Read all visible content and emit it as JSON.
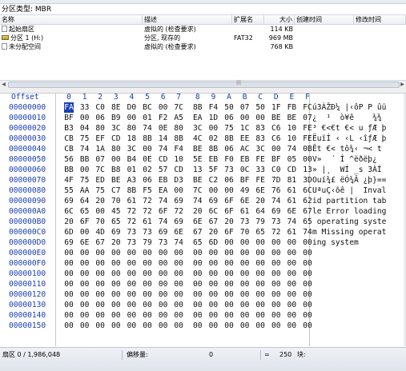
{
  "partition_type": "分区类型: MBR",
  "file_list": {
    "columns": [
      "名称",
      "描述",
      "扩展名",
      "大小",
      "创建时间",
      "修改时间"
    ],
    "rows": [
      {
        "name": "起始扇区",
        "desc": "虚拟的 (检查要求)",
        "ext": "",
        "size": "114 KB",
        "icon": "doc-icon"
      },
      {
        "name": "分区 1 (H:)",
        "desc": "分区, 现存的",
        "ext": "FAT32",
        "size": "969 MB",
        "icon": "drive-icon"
      },
      {
        "name": "未分配空间",
        "desc": "虚拟的 (检查要求)",
        "ext": "",
        "size": "768 KB",
        "icon": "doc-icon"
      }
    ]
  },
  "hex": {
    "offset_label": "Offset",
    "columns": [
      "0",
      "1",
      "2",
      "3",
      "4",
      "5",
      "6",
      "7",
      "8",
      "9",
      "A",
      "B",
      "C",
      "D",
      "E",
      "F"
    ],
    "rows": [
      {
        "offset": "00000000",
        "bytes": [
          "FA",
          "33",
          "C0",
          "8E",
          "D0",
          "BC",
          "00",
          "7C",
          "8B",
          "F4",
          "50",
          "07",
          "50",
          "1F",
          "FB",
          "FC"
        ],
        "ascii": "ú3ÀŽÐ¼ |‹ôP P ûü"
      },
      {
        "offset": "00000010",
        "bytes": [
          "BF",
          "00",
          "06",
          "B9",
          "00",
          "01",
          "F2",
          "A5",
          "EA",
          "1D",
          "06",
          "00",
          "00",
          "BE",
          "BE",
          "07"
        ],
        "ascii": "¿  ¹  ò¥ê    ¾¾"
      },
      {
        "offset": "00000020",
        "bytes": [
          "B3",
          "04",
          "80",
          "3C",
          "80",
          "74",
          "0E",
          "80",
          "3C",
          "00",
          "75",
          "1C",
          "83",
          "C6",
          "10",
          "FE"
        ],
        "ascii": "³ €<€t €< u ƒÆ þ"
      },
      {
        "offset": "00000030",
        "bytes": [
          "CB",
          "75",
          "EF",
          "CD",
          "18",
          "8B",
          "14",
          "8B",
          "4C",
          "02",
          "8B",
          "EE",
          "83",
          "C6",
          "10",
          "FE"
        ],
        "ascii": "ËuïÍ ‹ ‹L ‹îƒÆ þ"
      },
      {
        "offset": "00000040",
        "bytes": [
          "CB",
          "74",
          "1A",
          "80",
          "3C",
          "00",
          "74",
          "F4",
          "BE",
          "8B",
          "06",
          "AC",
          "3C",
          "00",
          "74",
          "0B"
        ],
        "ascii": "Ët €< tô¾‹ ¬< t"
      },
      {
        "offset": "00000050",
        "bytes": [
          "56",
          "BB",
          "07",
          "00",
          "B4",
          "0E",
          "CD",
          "10",
          "5E",
          "EB",
          "F0",
          "EB",
          "FE",
          "BF",
          "05",
          "00"
        ],
        "ascii": "V»  ´ Í ^ëðëþ¿"
      },
      {
        "offset": "00000060",
        "bytes": [
          "BB",
          "00",
          "7C",
          "B8",
          "01",
          "02",
          "57",
          "CD",
          "13",
          "5F",
          "73",
          "0C",
          "33",
          "C0",
          "CD",
          "13"
        ],
        "ascii": "» |¸  WÍ _s 3ÀÍ"
      },
      {
        "offset": "00000070",
        "bytes": [
          "4F",
          "75",
          "ED",
          "BE",
          "A3",
          "06",
          "EB",
          "D3",
          "BE",
          "C2",
          "06",
          "BF",
          "FE",
          "7D",
          "81",
          "3D"
        ],
        "ascii": "Ouí¾£ ëÓ¾Â ¿þ}=="
      },
      {
        "offset": "00000080",
        "bytes": [
          "55",
          "AA",
          "75",
          "C7",
          "8B",
          "F5",
          "EA",
          "00",
          "7C",
          "00",
          "00",
          "49",
          "6E",
          "76",
          "61",
          "6C"
        ],
        "ascii": "UªuÇ‹õê |  Inval"
      },
      {
        "offset": "00000090",
        "bytes": [
          "69",
          "64",
          "20",
          "70",
          "61",
          "72",
          "74",
          "69",
          "74",
          "69",
          "6F",
          "6E",
          "20",
          "74",
          "61",
          "62"
        ],
        "ascii": "id partition tab"
      },
      {
        "offset": "000000A0",
        "bytes": [
          "6C",
          "65",
          "00",
          "45",
          "72",
          "72",
          "6F",
          "72",
          "20",
          "6C",
          "6F",
          "61",
          "64",
          "69",
          "6E",
          "67"
        ],
        "ascii": "le Error loading"
      },
      {
        "offset": "000000B0",
        "bytes": [
          "20",
          "6F",
          "70",
          "65",
          "72",
          "61",
          "74",
          "69",
          "6E",
          "67",
          "20",
          "73",
          "79",
          "73",
          "74",
          "65"
        ],
        "ascii": " operating syste"
      },
      {
        "offset": "000000C0",
        "bytes": [
          "6D",
          "00",
          "4D",
          "69",
          "73",
          "73",
          "69",
          "6E",
          "67",
          "20",
          "6F",
          "70",
          "65",
          "72",
          "61",
          "74"
        ],
        "ascii": "m Missing operat"
      },
      {
        "offset": "000000D0",
        "bytes": [
          "69",
          "6E",
          "67",
          "20",
          "73",
          "79",
          "73",
          "74",
          "65",
          "6D",
          "00",
          "00",
          "00",
          "00",
          "00",
          "00"
        ],
        "ascii": "ing system"
      },
      {
        "offset": "000000E0",
        "bytes": [
          "00",
          "00",
          "00",
          "00",
          "00",
          "00",
          "00",
          "00",
          "00",
          "00",
          "00",
          "00",
          "00",
          "00",
          "00",
          "00"
        ],
        "ascii": ""
      },
      {
        "offset": "000000F0",
        "bytes": [
          "00",
          "00",
          "00",
          "00",
          "00",
          "00",
          "00",
          "00",
          "00",
          "00",
          "00",
          "00",
          "00",
          "00",
          "00",
          "00"
        ],
        "ascii": ""
      },
      {
        "offset": "00000100",
        "bytes": [
          "00",
          "00",
          "00",
          "00",
          "00",
          "00",
          "00",
          "00",
          "00",
          "00",
          "00",
          "00",
          "00",
          "00",
          "00",
          "00"
        ],
        "ascii": ""
      },
      {
        "offset": "00000110",
        "bytes": [
          "00",
          "00",
          "00",
          "00",
          "00",
          "00",
          "00",
          "00",
          "00",
          "00",
          "00",
          "00",
          "00",
          "00",
          "00",
          "00"
        ],
        "ascii": ""
      },
      {
        "offset": "00000120",
        "bytes": [
          "00",
          "00",
          "00",
          "00",
          "00",
          "00",
          "00",
          "00",
          "00",
          "00",
          "00",
          "00",
          "00",
          "00",
          "00",
          "00"
        ],
        "ascii": ""
      },
      {
        "offset": "00000130",
        "bytes": [
          "00",
          "00",
          "00",
          "00",
          "00",
          "00",
          "00",
          "00",
          "00",
          "00",
          "00",
          "00",
          "00",
          "00",
          "00",
          "00"
        ],
        "ascii": ""
      },
      {
        "offset": "00000140",
        "bytes": [
          "00",
          "00",
          "00",
          "00",
          "00",
          "00",
          "00",
          "00",
          "00",
          "00",
          "00",
          "00",
          "00",
          "00",
          "00",
          "00"
        ],
        "ascii": ""
      },
      {
        "offset": "00000150",
        "bytes": [
          "00",
          "00",
          "00",
          "00",
          "00",
          "00",
          "00",
          "00",
          "00",
          "00",
          "00",
          "00",
          "00",
          "00",
          "00",
          "00"
        ],
        "ascii": ""
      }
    ]
  },
  "status": {
    "sector": "扇区 0 / 1,986,048",
    "offset_label": "偏移量:",
    "offset_value": "0",
    "eq": "=",
    "value": "250",
    "block": "块:"
  },
  "colors": {
    "offset_blue": "#1a3fb5",
    "selection": "#1a3fb5"
  }
}
